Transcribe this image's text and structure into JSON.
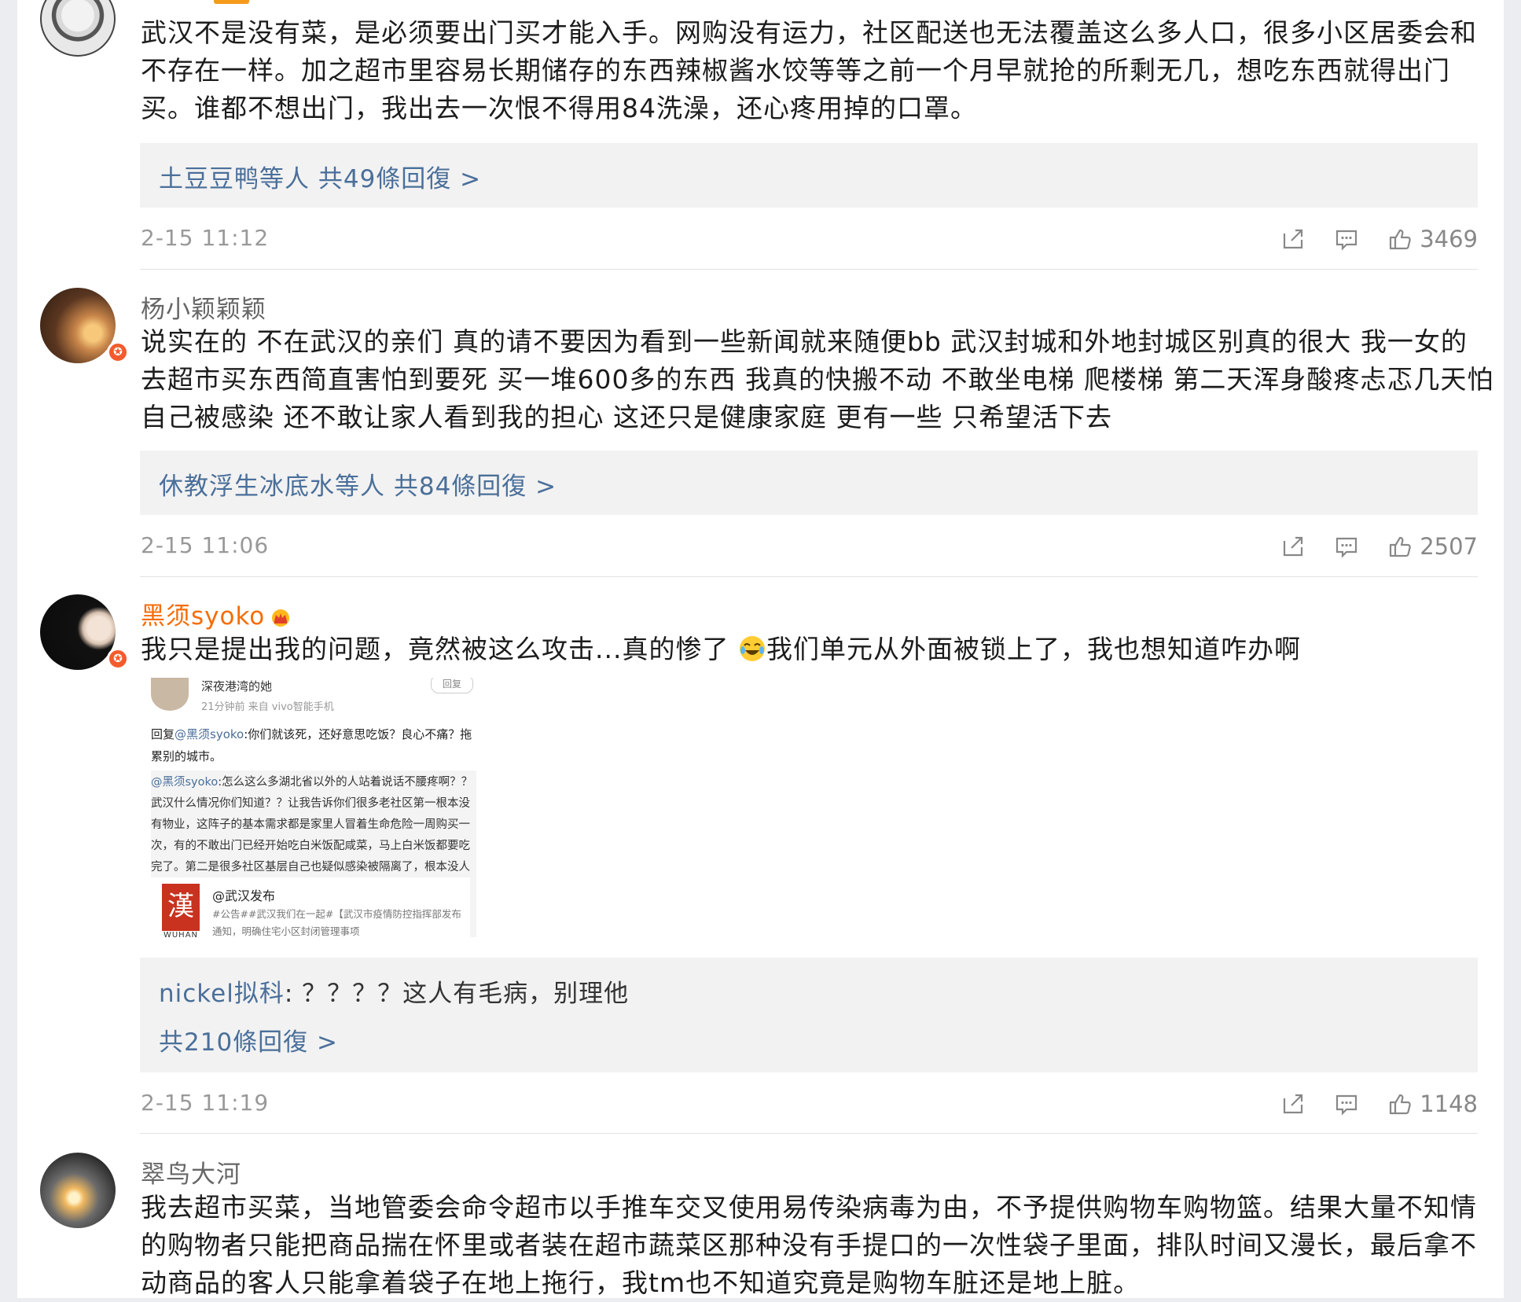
{
  "comments": [
    {
      "username": "",
      "text": "武汉不是没有菜，是必须要出门买才能入手。网购没有运力，社区配送也无法覆盖这么多人口，很多小区居委会和不存在一样。加之超市里容易长期储存的东西辣椒酱水饺等等之前一个月早就抢的所剩无几，想吃东西就得出门买。谁都不想出门，我出去一次恨不得用84洗澡，还心疼用掉的口罩。",
      "reply_summary": {
        "names": "土豆豆鸭等人",
        "count_text": " 共49條回復 >"
      },
      "time": "2-15 11:12",
      "likes": "3469",
      "avatar_icon": "avatar-icon"
    },
    {
      "username": "杨小颖颖颖",
      "text": "说实在的 不在武汉的亲们 真的请不要因为看到一些新闻就来随便bb 武汉封城和外地封城区别真的很大 我一女的 去超市买东西简直害怕到要死 买一堆600多的东西 我真的快搬不动 不敢坐电梯 爬楼梯 第二天浑身酸疼忐忑几天怕自己被感染 还不敢让家人看到我的担心 这还只是健康家庭 更有一些 只希望活下去",
      "reply_summary": {
        "names": "休教浮生冰底水等人",
        "count_text": " 共84條回復 >"
      },
      "time": "2-15 11:06",
      "likes": "2507",
      "avatar_icon": "avatar-icon"
    },
    {
      "username": "黑须syoko",
      "text_before_emoji": "我只是提出我的问题，竟然被这么攻击...真的惨了",
      "text_after_emoji": "我们单元从外面被锁上了，我也想知道咋办啊",
      "embedded_screenshot": {
        "name": "深夜港湾的她",
        "meta": "21分钟前  来自 vivo智能手机",
        "reply_btn": "回复",
        "reply_prefix": "回复",
        "reply_at": "@黑须syoko",
        "reply_text": ":你们就该死，还好意思吃饭？良心不痛？拖累别的城市。",
        "quote_at": "@黑须syoko",
        "quote_text": ":怎么这么多湖北省以外的人站着说话不腰疼啊？？武汉什么情况你们知道？？让我告诉你们很多老社区第一根本没有物业，这阵子的基本需求都是家里人冒着生命危险一周购买一次，有的不敢出门已经开始吃白米饭配咸菜，马上白米饭都要吃完了。第二是很多社区基层自己也疑似感染被隔离了，根本没人管！",
        "card_title": "@武汉发布",
        "card_text": "#公告##武汉我们在一起#【武汉市疫情防控指挥部发布通知，明确住宅小区封闭管理事项",
        "logo_char": "漢",
        "logo_sub": "WUHAN"
      },
      "reply_preview": {
        "name": "nickel拟科",
        "text": ": ？？？？这人有毛病，别理他"
      },
      "reply_total": "共210條回復 >",
      "time": "2-15 11:19",
      "likes": "1148"
    },
    {
      "username": "翠鸟大河",
      "text": "我去超市买菜，当地管委会命令超市以手推车交叉使用易传染病毒为由，不予提供购物车购物篮。结果大量不知情的购物者只能把商品揣在怀里或者装在超市蔬菜区那种没有手提口的一次性袋子里面，排队时间又漫长，最后拿不动商品的客人只能拿着袋子在地上拖行，我tm也不知道究竟是购物车脏还是地上脏。"
    }
  ],
  "icons": {
    "share": "share-icon",
    "comment": "comment-icon",
    "like": "like-icon",
    "verified": "verified-badge-icon",
    "crown": "vip-crown-icon",
    "emoji": "crying-laughing-emoji"
  },
  "colors": {
    "link": "#4a6f9a",
    "vip_name": "#f56d07",
    "badge": "#f55a2c"
  }
}
